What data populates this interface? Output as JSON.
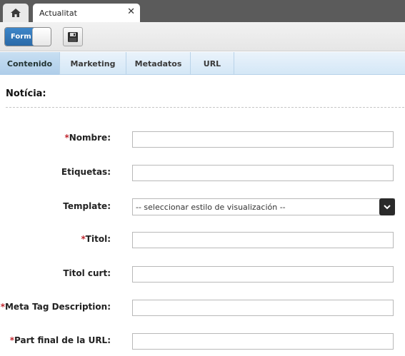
{
  "topbar": {
    "tab_title": "Actualitat",
    "close_glyph": "✕"
  },
  "toolbar": {
    "toggle_label": "Form"
  },
  "tabs": [
    {
      "label": "Contenido"
    },
    {
      "label": "Marketing"
    },
    {
      "label": "Metadatos"
    },
    {
      "label": "URL"
    }
  ],
  "section_title": "Notícia:",
  "required_marker": "*",
  "fields": [
    {
      "label": "Nombre:",
      "required": true,
      "value": ""
    },
    {
      "label": "Etiquetas:",
      "required": false,
      "value": ""
    },
    {
      "label": "Template:",
      "required": false,
      "select_value": "-- seleccionar estilo de visualización --"
    },
    {
      "label": "Titol:",
      "required": true,
      "value": ""
    },
    {
      "label": "Titol curt:",
      "required": false,
      "value": ""
    },
    {
      "label": "Meta Tag Description:",
      "required": true,
      "value": ""
    },
    {
      "label": "Part final de la URL:",
      "required": true,
      "value": ""
    }
  ],
  "colors": {
    "topbar": "#5b5b5b",
    "toggle_on": "#2f74b5",
    "tab_strip": "#d4e7f6",
    "tab_active": "#aecde9",
    "required": "#c0262e"
  },
  "icons": [
    "home-icon",
    "close-icon",
    "save-icon",
    "chevron-down-icon"
  ]
}
